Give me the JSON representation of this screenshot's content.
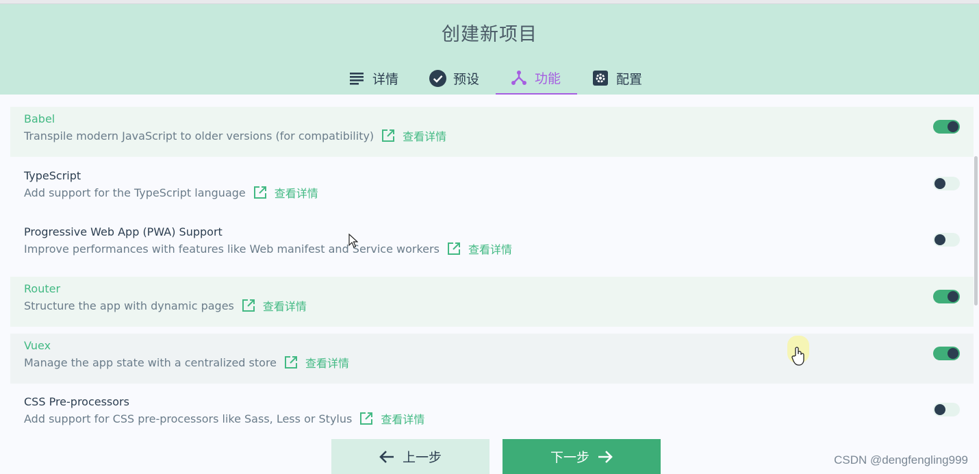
{
  "header": {
    "title": "创建新项目",
    "tabs": [
      {
        "label": "详情",
        "icon": "list-icon"
      },
      {
        "label": "预设",
        "icon": "check-circle-icon"
      },
      {
        "label": "功能",
        "icon": "fork-icon",
        "active": true
      },
      {
        "label": "配置",
        "icon": "settings-icon"
      }
    ]
  },
  "features": [
    {
      "name": "Babel",
      "description": "Transpile modern JavaScript to older versions (for compatibility)",
      "link_label": "查看详情",
      "enabled": true
    },
    {
      "name": "TypeScript",
      "description": "Add support for the TypeScript language",
      "link_label": "查看详情",
      "enabled": false
    },
    {
      "name": "Progressive Web App (PWA) Support",
      "description": "Improve performances with features like Web manifest and Service workers",
      "link_label": "查看详情",
      "enabled": false
    },
    {
      "name": "Router",
      "description": "Structure the app with dynamic pages",
      "link_label": "查看详情",
      "enabled": true
    },
    {
      "name": "Vuex",
      "description": "Manage the app state with a centralized store",
      "link_label": "查看详情",
      "enabled": true
    },
    {
      "name": "CSS Pre-processors",
      "description": "Add support for CSS pre-processors like Sass, Less or Stylus",
      "link_label": "查看详情",
      "enabled": false
    }
  ],
  "footer": {
    "prev_label": "上一步",
    "next_label": "下一步"
  },
  "watermark": "CSDN @dengfengling999",
  "colors": {
    "header_bg": "#c6e9dc",
    "accent_green": "#42b983",
    "active_tab": "#a55ee0",
    "next_button": "#3dad77"
  }
}
